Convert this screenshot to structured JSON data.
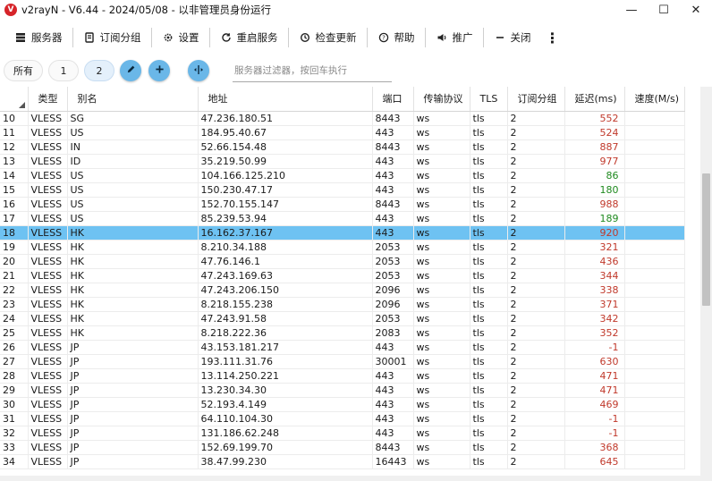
{
  "window": {
    "logo_letter": "V",
    "title": "v2rayN - V6.44 - 2024/05/08 - 以非管理员身份运行",
    "minimize_glyph": "—",
    "maximize_glyph": "☐",
    "close_glyph": "✕"
  },
  "toolbar": {
    "servers_label": "服务器",
    "servers_icon": "server-icon",
    "subscription_label": "订阅分组",
    "subscription_icon": "subscription-icon",
    "settings_label": "设置",
    "settings_icon": "gear-icon",
    "restart_label": "重启服务",
    "restart_icon": "refresh-icon",
    "update_label": "检查更新",
    "update_icon": "history-icon",
    "help_label": "帮助",
    "help_icon": "help-icon",
    "promote_label": "推广",
    "promote_icon": "speaker-icon",
    "close_label": "关闭",
    "close_icon": "minus-icon"
  },
  "filterbar": {
    "tabs": [
      "所有",
      "1",
      "2"
    ],
    "active_tab": "2",
    "filter_placeholder": "服务器过滤器，按回车执行"
  },
  "grid": {
    "columns": [
      "类型",
      "别名",
      "地址",
      "端口",
      "传输协议",
      "TLS",
      "订阅分组",
      "延迟(ms)",
      "速度(M/s)"
    ],
    "selected_index": "18",
    "rows": [
      {
        "index": "10",
        "type": "VLESS",
        "alias": "SG",
        "address": "47.236.180.51",
        "port": "8443",
        "transport": "ws",
        "tls": "tls",
        "sub": "2",
        "delay": "552",
        "speed": ""
      },
      {
        "index": "11",
        "type": "VLESS",
        "alias": "US",
        "address": "184.95.40.67",
        "port": "443",
        "transport": "ws",
        "tls": "tls",
        "sub": "2",
        "delay": "524",
        "speed": ""
      },
      {
        "index": "12",
        "type": "VLESS",
        "alias": "IN",
        "address": "52.66.154.48",
        "port": "8443",
        "transport": "ws",
        "tls": "tls",
        "sub": "2",
        "delay": "887",
        "speed": ""
      },
      {
        "index": "13",
        "type": "VLESS",
        "alias": "ID",
        "address": "35.219.50.99",
        "port": "443",
        "transport": "ws",
        "tls": "tls",
        "sub": "2",
        "delay": "977",
        "speed": ""
      },
      {
        "index": "14",
        "type": "VLESS",
        "alias": "US",
        "address": "104.166.125.210",
        "port": "443",
        "transport": "ws",
        "tls": "tls",
        "sub": "2",
        "delay": "86",
        "speed": ""
      },
      {
        "index": "15",
        "type": "VLESS",
        "alias": "US",
        "address": "150.230.47.17",
        "port": "443",
        "transport": "ws",
        "tls": "tls",
        "sub": "2",
        "delay": "180",
        "speed": ""
      },
      {
        "index": "16",
        "type": "VLESS",
        "alias": "US",
        "address": "152.70.155.147",
        "port": "8443",
        "transport": "ws",
        "tls": "tls",
        "sub": "2",
        "delay": "988",
        "speed": ""
      },
      {
        "index": "17",
        "type": "VLESS",
        "alias": "US",
        "address": "85.239.53.94",
        "port": "443",
        "transport": "ws",
        "tls": "tls",
        "sub": "2",
        "delay": "189",
        "speed": ""
      },
      {
        "index": "18",
        "type": "VLESS",
        "alias": "HK",
        "address": "16.162.37.167",
        "port": "443",
        "transport": "ws",
        "tls": "tls",
        "sub": "2",
        "delay": "920",
        "speed": ""
      },
      {
        "index": "19",
        "type": "VLESS",
        "alias": "HK",
        "address": "8.210.34.188",
        "port": "2053",
        "transport": "ws",
        "tls": "tls",
        "sub": "2",
        "delay": "321",
        "speed": ""
      },
      {
        "index": "20",
        "type": "VLESS",
        "alias": "HK",
        "address": "47.76.146.1",
        "port": "2053",
        "transport": "ws",
        "tls": "tls",
        "sub": "2",
        "delay": "436",
        "speed": ""
      },
      {
        "index": "21",
        "type": "VLESS",
        "alias": "HK",
        "address": "47.243.169.63",
        "port": "2053",
        "transport": "ws",
        "tls": "tls",
        "sub": "2",
        "delay": "344",
        "speed": ""
      },
      {
        "index": "22",
        "type": "VLESS",
        "alias": "HK",
        "address": "47.243.206.150",
        "port": "2096",
        "transport": "ws",
        "tls": "tls",
        "sub": "2",
        "delay": "338",
        "speed": ""
      },
      {
        "index": "23",
        "type": "VLESS",
        "alias": "HK",
        "address": "8.218.155.238",
        "port": "2096",
        "transport": "ws",
        "tls": "tls",
        "sub": "2",
        "delay": "371",
        "speed": ""
      },
      {
        "index": "24",
        "type": "VLESS",
        "alias": "HK",
        "address": "47.243.91.58",
        "port": "2053",
        "transport": "ws",
        "tls": "tls",
        "sub": "2",
        "delay": "342",
        "speed": ""
      },
      {
        "index": "25",
        "type": "VLESS",
        "alias": "HK",
        "address": "8.218.222.36",
        "port": "2083",
        "transport": "ws",
        "tls": "tls",
        "sub": "2",
        "delay": "352",
        "speed": ""
      },
      {
        "index": "26",
        "type": "VLESS",
        "alias": "JP",
        "address": "43.153.181.217",
        "port": "443",
        "transport": "ws",
        "tls": "tls",
        "sub": "2",
        "delay": "-1",
        "speed": ""
      },
      {
        "index": "27",
        "type": "VLESS",
        "alias": "JP",
        "address": "193.111.31.76",
        "port": "30001",
        "transport": "ws",
        "tls": "tls",
        "sub": "2",
        "delay": "630",
        "speed": ""
      },
      {
        "index": "28",
        "type": "VLESS",
        "alias": "JP",
        "address": "13.114.250.221",
        "port": "443",
        "transport": "ws",
        "tls": "tls",
        "sub": "2",
        "delay": "471",
        "speed": ""
      },
      {
        "index": "29",
        "type": "VLESS",
        "alias": "JP",
        "address": "13.230.34.30",
        "port": "443",
        "transport": "ws",
        "tls": "tls",
        "sub": "2",
        "delay": "471",
        "speed": ""
      },
      {
        "index": "30",
        "type": "VLESS",
        "alias": "JP",
        "address": "52.193.4.149",
        "port": "443",
        "transport": "ws",
        "tls": "tls",
        "sub": "2",
        "delay": "469",
        "speed": ""
      },
      {
        "index": "31",
        "type": "VLESS",
        "alias": "JP",
        "address": "64.110.104.30",
        "port": "443",
        "transport": "ws",
        "tls": "tls",
        "sub": "2",
        "delay": "-1",
        "speed": ""
      },
      {
        "index": "32",
        "type": "VLESS",
        "alias": "JP",
        "address": "131.186.62.248",
        "port": "443",
        "transport": "ws",
        "tls": "tls",
        "sub": "2",
        "delay": "-1",
        "speed": ""
      },
      {
        "index": "33",
        "type": "VLESS",
        "alias": "JP",
        "address": "152.69.199.70",
        "port": "8443",
        "transport": "ws",
        "tls": "tls",
        "sub": "2",
        "delay": "368",
        "speed": ""
      },
      {
        "index": "34",
        "type": "VLESS",
        "alias": "JP",
        "address": "38.47.99.230",
        "port": "16443",
        "transport": "ws",
        "tls": "tls",
        "sub": "2",
        "delay": "645",
        "speed": ""
      }
    ]
  },
  "colors": {
    "delay_fast": "#1f8a1f",
    "delay_slow": "#c0392b",
    "selected_row": "#6ec2f2",
    "accent_button": "#6ab7e8",
    "logo_red": "#d6242a"
  }
}
